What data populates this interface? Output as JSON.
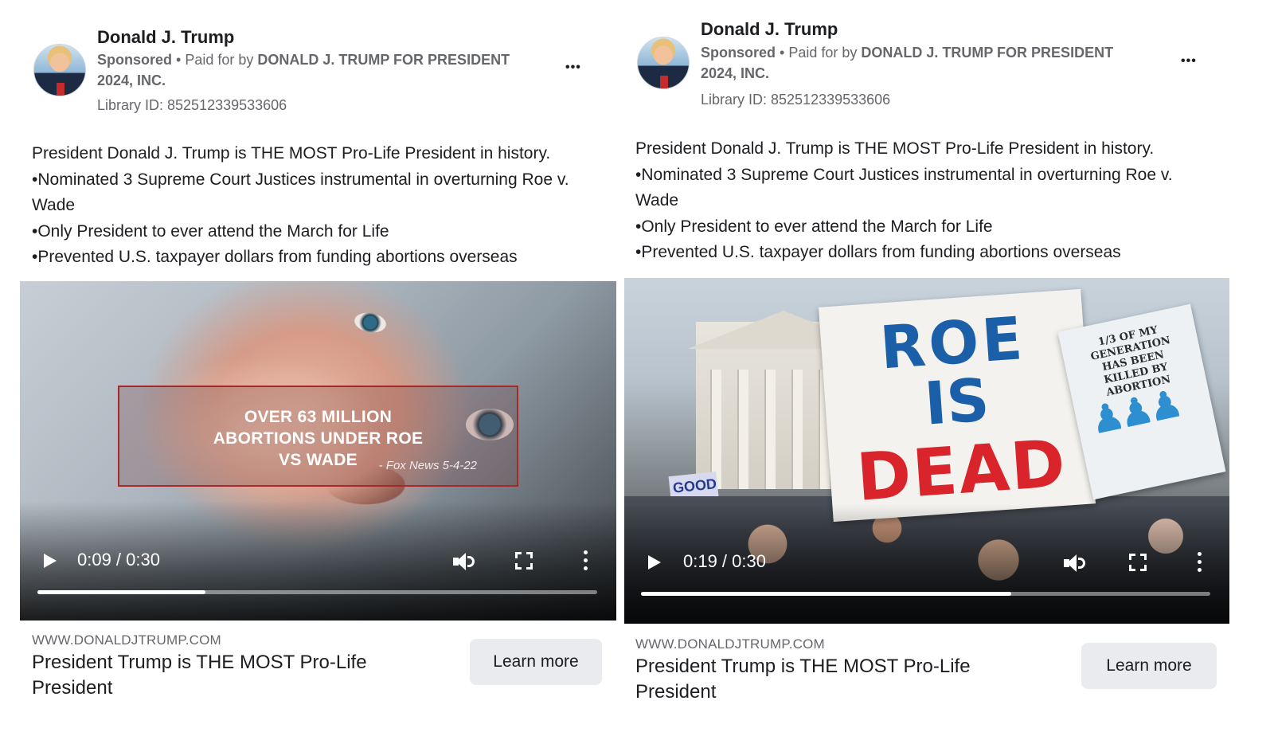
{
  "ads": [
    {
      "advertiser_name": "Donald J. Trump",
      "sponsored_label": "Sponsored",
      "paid_for_prefix": " • Paid for by ",
      "paid_for_entity": "DONALD J. TRUMP FOR PRESIDENT 2024, INC.",
      "library_id": "Library ID: 852512339533606",
      "more_options": "•••",
      "body_lines": [
        "President Donald J. Trump is THE MOST Pro-Life President in history.",
        "•Nominated 3 Supreme Court Justices instrumental in overturning Roe v. Wade",
        "•Only President to ever attend the March for Life",
        "•Prevented U.S. taxpayer dollars from funding abortions overseas"
      ],
      "video": {
        "overlay_title": "OVER 63 MILLION ABORTIONS UNDER ROE VS WADE",
        "overlay_source": "- Fox News 5-4-22",
        "time_display": "0:09 / 0:30",
        "progress": 0.3
      },
      "link_domain": "WWW.DONALDJTRUMP.COM",
      "link_headline": "President Trump is THE MOST Pro-Life President",
      "cta_label": "Learn more"
    },
    {
      "advertiser_name": "Donald J. Trump",
      "sponsored_label": "Sponsored",
      "paid_for_prefix": " • Paid for by ",
      "paid_for_entity": "DONALD J. TRUMP FOR PRESIDENT 2024, INC.",
      "library_id": "Library ID: 852512339533606",
      "more_options": "•••",
      "body_lines": [
        "President Donald J. Trump is THE MOST Pro-Life President in history.",
        "•Nominated 3 Supreme Court Justices instrumental in overturning Roe v. Wade",
        "•Only President to ever attend the March for Life",
        "•Prevented U.S. taxpayer dollars from funding abortions overseas"
      ],
      "video": {
        "sign_line1": "ROE",
        "sign_line2": "IS",
        "sign_line3": "DEAD",
        "sign_secondary": "1/3 OF MY GENERATION HAS BEEN KILLED BY ABORTION",
        "time_display": "0:19 / 0:30",
        "progress": 0.65
      },
      "link_domain": "WWW.DONALDJTRUMP.COM",
      "link_headline": "President Trump is THE MOST Pro-Life President",
      "cta_label": "Learn more"
    }
  ],
  "colors": {
    "text_primary": "#1c1e21",
    "text_secondary": "#65676b",
    "button_bg": "#e9ebee",
    "caption_border": "#a5282a",
    "sign_blue": "#1b5fa8",
    "sign_red": "#d8242a"
  }
}
